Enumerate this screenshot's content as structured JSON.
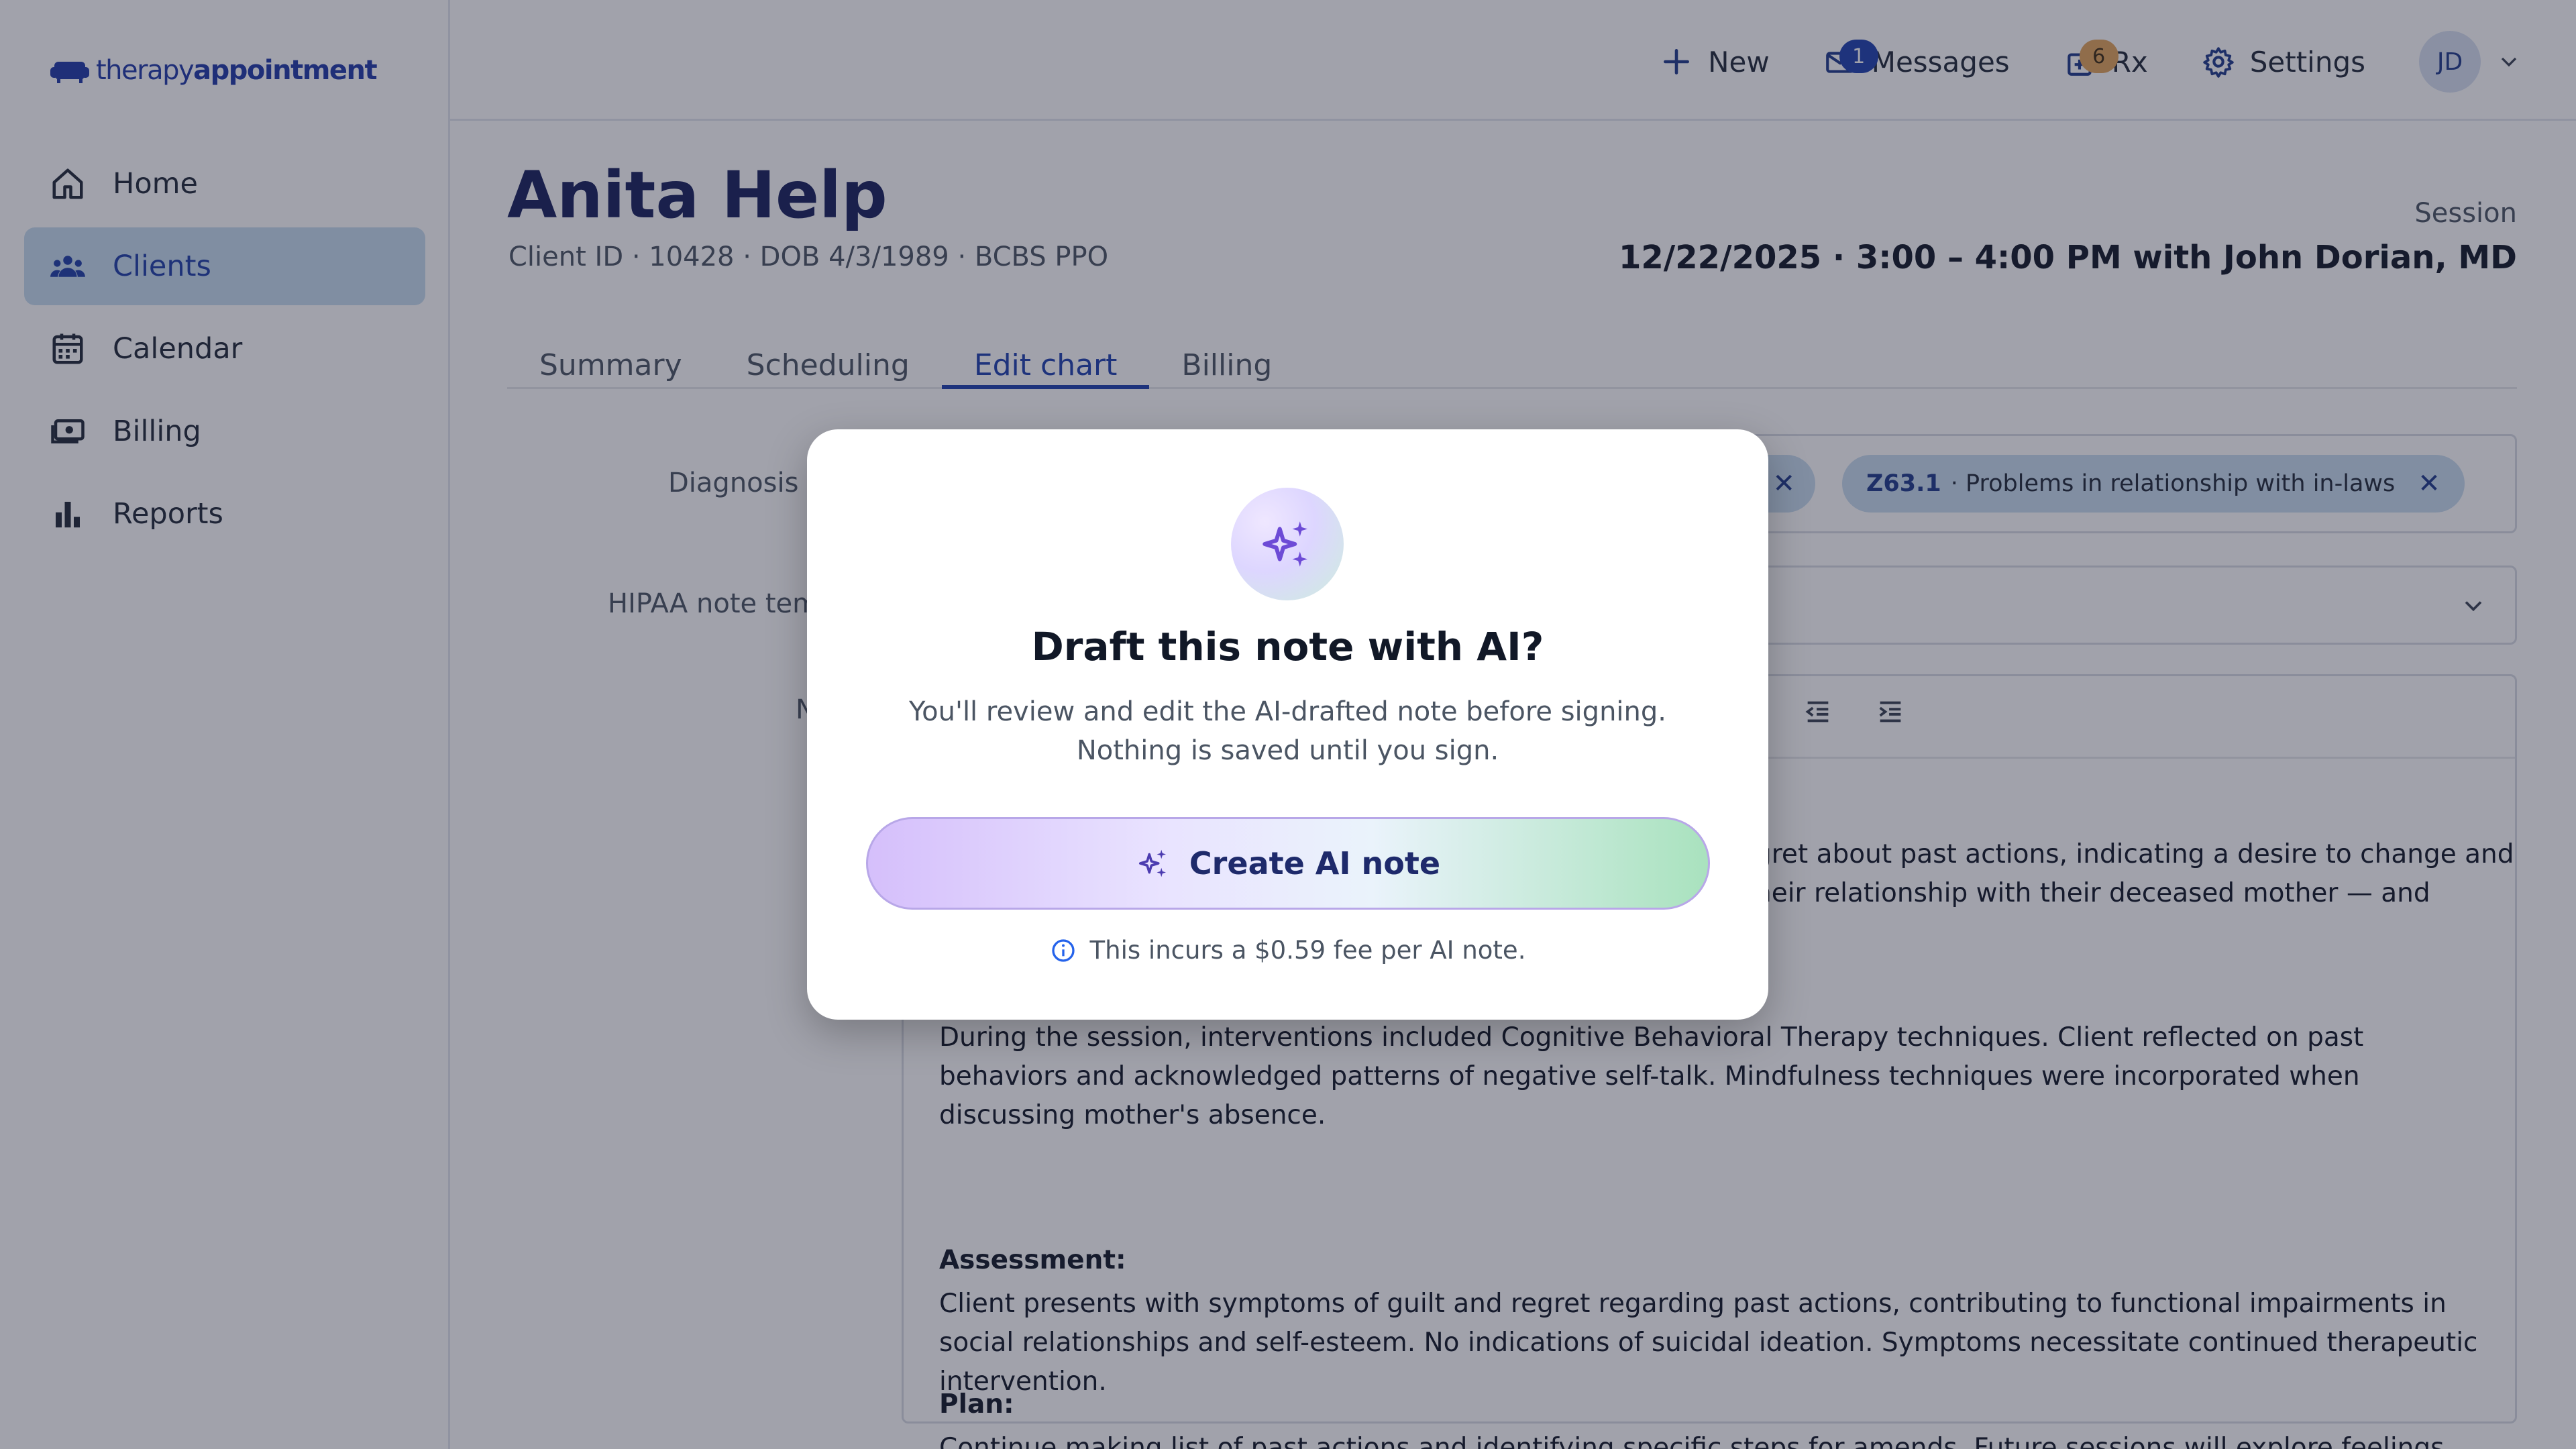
{
  "app": {
    "logo_light": "therapy",
    "logo_bold": "appointment"
  },
  "sidebar": {
    "items": [
      {
        "label": "Home",
        "icon": "home-icon",
        "active": false
      },
      {
        "label": "Clients",
        "icon": "users-icon",
        "active": true
      },
      {
        "label": "Calendar",
        "icon": "calendar-icon",
        "active": false
      },
      {
        "label": "Billing",
        "icon": "cash-icon",
        "active": false
      },
      {
        "label": "Reports",
        "icon": "bar-chart-icon",
        "active": false
      }
    ]
  },
  "topbar": {
    "new_label": "New",
    "messages_label": "Messages",
    "messages_count": "1",
    "rx_label": "Rx",
    "rx_count": "6",
    "settings_label": "Settings",
    "avatar_initials": "JD"
  },
  "client": {
    "name": "Anita Help",
    "meta": "Client ID · 10428 · DOB 4/3/1989 · BCBS PPO",
    "session_label": "Session",
    "session_value": "12/22/2025 · 3:00 – 4:00 PM with John Dorian, MD"
  },
  "tabs": [
    "Summary",
    "Scheduling",
    "Edit chart",
    "Billing"
  ],
  "form": {
    "diagnosis_label": "Diagnosis c",
    "template_label": "HIPAA note tem",
    "note_label": "N",
    "chip_code": "Z63.1",
    "chip_text": "· Problems in relationship with in-laws"
  },
  "note": {
    "line1": "gret about past actions, indicating a desire to change and",
    "line2": "heir relationship with their deceased mother — and",
    "intervention": "During the session, interventions included Cognitive Behavioral Therapy techniques. Client reflected on past behaviors and acknowledged patterns of negative self-talk. Mindfulness techniques were incorporated when discussing mother's absence.",
    "assessment_head": "Assessment:",
    "assessment": "Client presents with symptoms of guilt and regret regarding past actions, contributing to functional impairments in social relationships and self-esteem. No indications of suicidal ideation. Symptoms necessitate continued therapeutic intervention.",
    "plan_head": "Plan:",
    "plan": "Continue making list of past actions and identifying specific steps for amends. Future sessions will explore feelings about mother and impact on current life."
  },
  "modal": {
    "title": "Draft this note with AI?",
    "body": "You'll review and edit the AI-drafted note before signing. Nothing is saved until you sign.",
    "button_label": "Create AI note",
    "fee_text": "This incurs a $0.59 fee per AI note."
  },
  "colors": {
    "brand": "#1f3aa8",
    "accent": "#1e40af",
    "active_nav_bg": "#c7dcef",
    "button_gradient_start": "#d5bffb",
    "button_gradient_end": "#a9e2be"
  }
}
